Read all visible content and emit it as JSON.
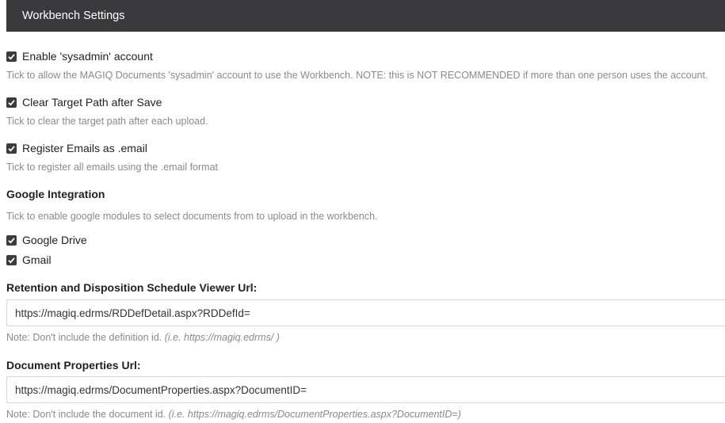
{
  "header": {
    "title": "Workbench Settings"
  },
  "settings": {
    "sysadmin": {
      "checked": true,
      "label": "Enable 'sysadmin' account",
      "help": "Tick to allow the MAGIQ Documents 'sysadmin' account to use the Workbench. NOTE: this is NOT RECOMMENDED if more than one person uses the account."
    },
    "clear_target": {
      "checked": true,
      "label": "Clear Target Path after Save",
      "help": "Tick to clear the target path after each upload."
    },
    "register_emails": {
      "checked": true,
      "label": "Register Emails as .email",
      "help": "Tick to register all emails using the .email format"
    }
  },
  "google": {
    "title": "Google Integration",
    "help": "Tick to enable google modules to select documents from to upload in the workbench.",
    "drive": {
      "checked": true,
      "label": "Google Drive"
    },
    "gmail": {
      "checked": true,
      "label": "Gmail"
    }
  },
  "retention": {
    "title": "Retention and Disposition Schedule Viewer Url:",
    "value": "https://magiq.edrms/RDDefDetail.aspx?RDDefId=",
    "note": "Note: Don't include the definition id.",
    "note_example": "(i.e. https://magiq.edrms/ )"
  },
  "doc_props": {
    "title": "Document Properties Url:",
    "value": "https://magiq.edrms/DocumentProperties.aspx?DocumentID=",
    "note": "Note: Don't include the document id.",
    "note_example": "(i.e. https://magiq.edrms/DocumentProperties.aspx?DocumentID=)"
  }
}
